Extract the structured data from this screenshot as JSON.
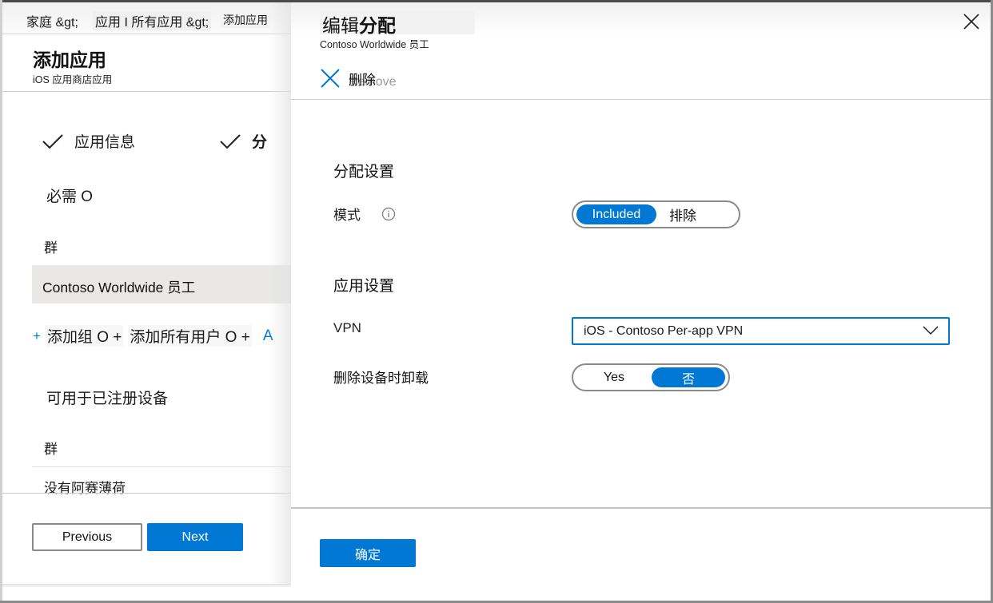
{
  "breadcrumb": {
    "home": "家庭 &gt;",
    "apps": "应用 I 所有应用 &gt;",
    "current": "添加应用"
  },
  "left_blade": {
    "title": "添加应用",
    "subtitle": "iOS 应用商店应用",
    "steps": [
      {
        "label": "应用信息",
        "status": "complete"
      },
      {
        "label": "分",
        "status": "complete"
      }
    ],
    "required_section": {
      "title": "必需 O",
      "group_header": "群",
      "groups": [
        "Contoso Worldwide 员工"
      ],
      "add_links": {
        "plus1": "+",
        "add_group": "添加组 O +",
        "add_all_users": "添加所有用户 O +",
        "more": "A"
      }
    },
    "available_section": {
      "title": "可用于已注册设备",
      "group_header": "群",
      "empty_text": "没有阿赛薄荷"
    },
    "buttons": {
      "previous": "Previous",
      "next": "Next"
    }
  },
  "right_blade": {
    "title_regular": "编辑",
    "title_bold": "分配",
    "subtitle": "Contoso Worldwide 员工",
    "remove_label": "删除",
    "remove_ghost": "Remove",
    "assignment_settings": {
      "title": "分配设置",
      "mode_label": "模式",
      "mode_options": [
        "Included",
        "排除"
      ],
      "mode_selected": "Included"
    },
    "app_settings": {
      "title": "应用设置",
      "vpn_label": "VPN",
      "vpn_value": "iOS - Contoso Per-app VPN",
      "uninstall_label": "删除设备时卸载",
      "uninstall_options": [
        "Yes",
        "否"
      ],
      "uninstall_selected": "否"
    },
    "ok_button": "确定"
  },
  "colors": {
    "accent": "#0078d4",
    "selected_row": "#e9e8e7",
    "border": "#8a8a8a"
  }
}
